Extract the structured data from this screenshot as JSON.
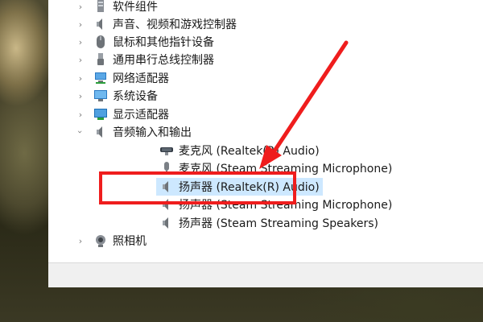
{
  "device_tree": {
    "items": [
      {
        "label": "软件组件",
        "icon": "software-component-icon",
        "expandable": true
      },
      {
        "label": "声音、视频和游戏控制器",
        "icon": "speaker-icon",
        "expandable": true
      },
      {
        "label": "鼠标和其他指针设备",
        "icon": "mouse-icon",
        "expandable": true
      },
      {
        "label": "通用串行总线控制器",
        "icon": "usb-icon",
        "expandable": true
      },
      {
        "label": "网络适配器",
        "icon": "network-adapter-icon",
        "expandable": true
      },
      {
        "label": "系统设备",
        "icon": "system-device-icon",
        "expandable": true
      },
      {
        "label": "显示适配器",
        "icon": "display-adapter-icon",
        "expandable": true
      },
      {
        "label": "音频输入和输出",
        "icon": "speaker-icon",
        "expandable": true,
        "expanded": true,
        "children": [
          {
            "label": "麦克风 (Realtek(R) Audio)",
            "icon": "microphone-icon"
          },
          {
            "label": "麦克风 (Steam Streaming Microphone)",
            "icon": "microphone-icon"
          },
          {
            "label": "扬声器 (Realtek(R) Audio)",
            "icon": "speaker-icon",
            "selected": true
          },
          {
            "label": "扬声器 (Steam Streaming Microphone)",
            "icon": "speaker-icon"
          },
          {
            "label": "扬声器 (Steam Streaming Speakers)",
            "icon": "speaker-icon"
          }
        ]
      },
      {
        "label": "照相机",
        "icon": "camera-icon",
        "expandable": true
      }
    ]
  },
  "colors": {
    "annotation": "#ef1d1d",
    "selection": "#cde8ff"
  }
}
